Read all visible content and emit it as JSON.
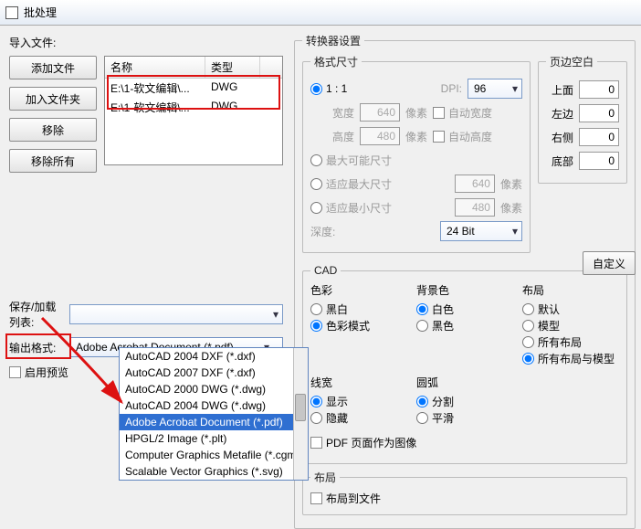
{
  "window": {
    "title": "批处理"
  },
  "left": {
    "import_label": "导入文件:",
    "buttons": {
      "add_file": "添加文件",
      "add_folder": "加入文件夹",
      "remove": "移除",
      "remove_all": "移除所有"
    },
    "table": {
      "col_name": "名称",
      "col_type": "类型",
      "rows": [
        {
          "name": "E:\\1-软文编辑\\...",
          "type": "DWG"
        },
        {
          "name": "E:\\1-软文编辑\\...",
          "type": "DWG"
        }
      ]
    },
    "save_list_label": "保存/加载列表:",
    "output_format_label": "输出格式:",
    "output_format_value": "Adobe Acrobat Document (*.pdf)",
    "dropdown": [
      "AutoCAD 2004 DXF (*.dxf)",
      "AutoCAD 2007 DXF (*.dxf)",
      "AutoCAD 2000 DWG (*.dwg)",
      "AutoCAD 2004 DWG (*.dwg)",
      "Adobe Acrobat Document (*.pdf)",
      "HPGL/2 Image (*.plt)",
      "Computer Graphics Metafile (*.cgm)",
      "Scalable Vector Graphics (*.svg)"
    ],
    "enable_preview": "启用预览"
  },
  "right": {
    "converter_title": "转换器设置",
    "format_size_title": "格式尺寸",
    "ratio_11": "1 : 1",
    "dpi_label": "DPI:",
    "dpi_value": "96",
    "width_label": "宽度",
    "width_value": "640",
    "px": "像素",
    "auto_width": "自动宽度",
    "height_label": "高度",
    "height_value": "480",
    "auto_height": "自动高度",
    "max_possible": "最大可能尺寸",
    "fit_max": "适应最大尺寸",
    "fit_max_value": "640",
    "fit_min": "适应最小尺寸",
    "fit_min_value": "480",
    "depth_label": "深度:",
    "depth_value": "24 Bit",
    "margins_title": "页边空白",
    "margin_top": "上面",
    "margin_left": "左边",
    "margin_right": "右侧",
    "margin_bottom": "底部",
    "margin_value": "0",
    "custom_btn": "自定义",
    "cad_title": "CAD",
    "color_title": "色彩",
    "bw": "黑白",
    "color_mode": "色彩模式",
    "bg_title": "背景色",
    "bg_white": "白色",
    "bg_black": "黑色",
    "layout_title": "布局",
    "default": "默认",
    "model": "模型",
    "all_layouts": "所有布局",
    "all_and_model": "所有布局与模型",
    "linew_title": "线宽",
    "show": "显示",
    "hide": "隐藏",
    "arc_title": "圆弧",
    "segment": "分割",
    "smooth": "平滑",
    "pdf_as_image": "PDF 页面作为图像",
    "layout2_title": "布局",
    "layout_to_file": "布局到文件"
  }
}
